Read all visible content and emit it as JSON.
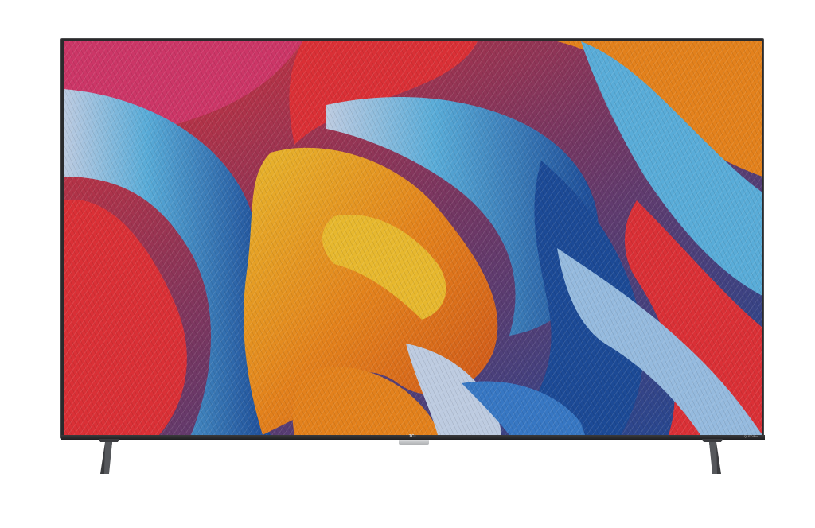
{
  "product": {
    "logo_text": "TCL",
    "model_badge": "QLED/Pro"
  },
  "image": {
    "subject": "flat-screen-television",
    "screen_content": "abstract-swirling-lines-wallpaper",
    "colors": {
      "red": "#e8343a",
      "magenta": "#d93a6e",
      "orange": "#f28a1e",
      "yellow": "#f6c431",
      "sky_blue": "#5fb7e6",
      "deep_blue": "#1e4fa0",
      "pale_blue": "#c9d8ef",
      "frame": "#2a2a2c"
    }
  }
}
